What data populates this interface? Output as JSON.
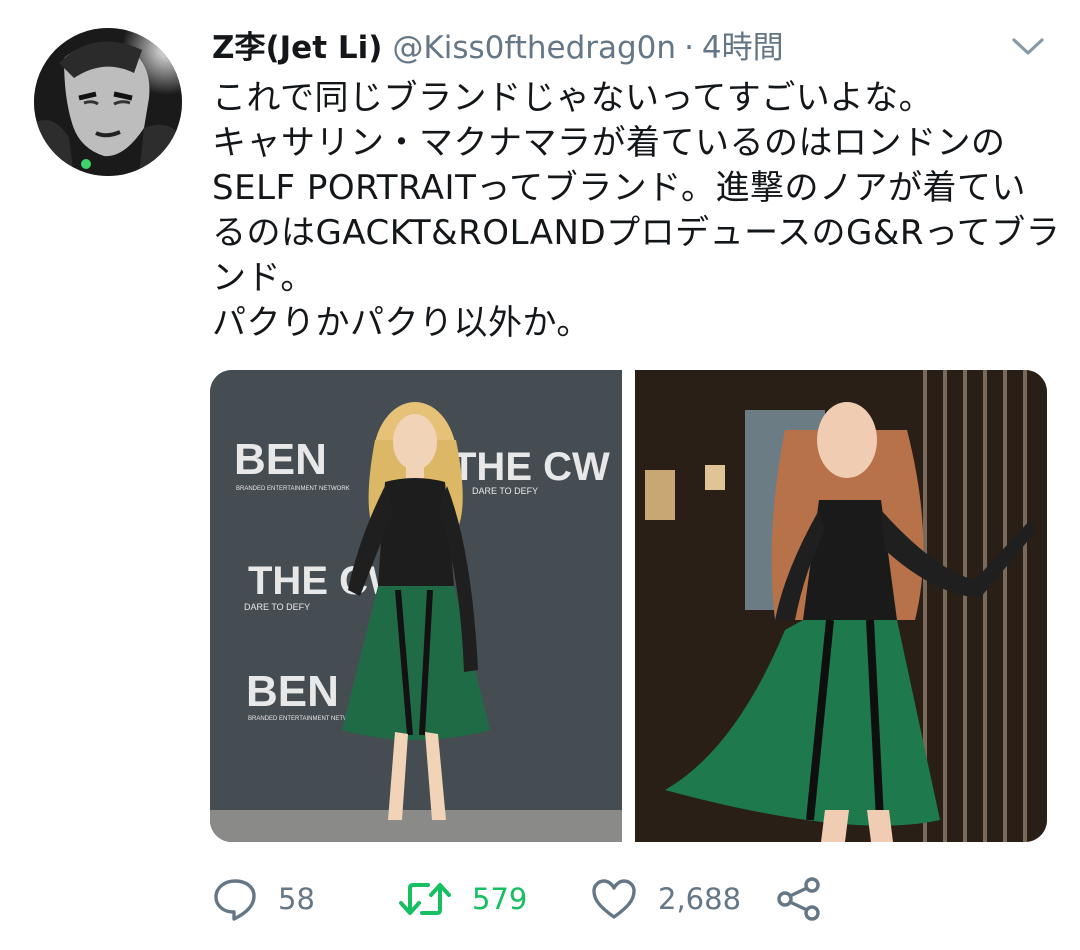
{
  "user": {
    "display_name": "Z李(Jet Li)",
    "handle": "@Kiss0fthedrag0n",
    "separator": "·",
    "time": "4時間",
    "avatar_icon": "user-avatar"
  },
  "tweet": {
    "lines": [
      "これで同じブランドじゃないってすごいよな。",
      "キャサリン・マクナマラが着ているのはロンドンの",
      "SELF PORTRAITってブランド。進撃のノアが着てい",
      "るのはGACKT&ROLANDプロデュースのG&Rってブラ",
      "ンド。",
      "パクりかパクり以外か。"
    ]
  },
  "media": {
    "photo_1": {
      "backdrop_lines": [
        "BEN",
        "BRANDED ENTERTAINMENT NETWORK",
        "THE CW",
        "DARE TO DEFY",
        "THE CW",
        "DARE TO DEFY",
        "BEN",
        "BRANDED ENTERTAINMENT NETWORK"
      ]
    }
  },
  "actions": {
    "reply_count": "58",
    "retweet_count": "579",
    "like_count": "2,688"
  },
  "colors": {
    "text": "#14171a",
    "secondary": "#657786",
    "retweet": "#17bf63",
    "dress_green": "#1f6b45"
  }
}
